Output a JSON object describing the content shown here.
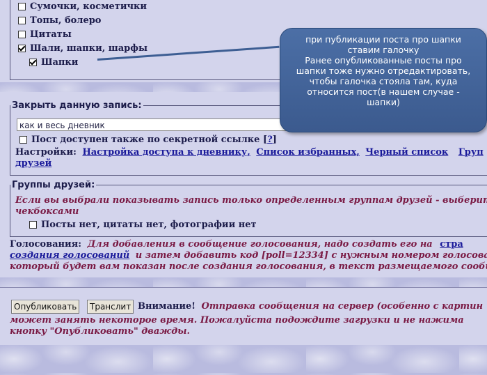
{
  "categories": {
    "items": [
      {
        "label": "Сумочки, косметички",
        "checked": false
      },
      {
        "label": "Топы, болеро",
        "checked": false
      },
      {
        "label": "Цитаты",
        "checked": false
      },
      {
        "label": "Шали, шапки, шарфы",
        "checked": true
      },
      {
        "label": "Шапки",
        "checked": true
      }
    ]
  },
  "callout": {
    "lines": [
      "при публикации поста про шапки",
      "ставим галочку",
      "Ранее опубликованные посты про",
      "шапки тоже нужно отредактировать,",
      "чтобы галочка стояла там, куда",
      "относится пост(в нашем случае -",
      "шапки)"
    ]
  },
  "close_entry": {
    "legend": "Закрыть данную запись:",
    "select_value": "как и весь дневник",
    "secret_link_label": "Пост доступен также по секретной ссылке [",
    "secret_link_q": "?",
    "secret_link_end": "]",
    "settings_label": "Настройки:",
    "links": [
      "Настройка доступа к дневнику,",
      "Список избранных,",
      "Черный список",
      "Груп"
    ],
    "links_line2": "друзей"
  },
  "friend_groups": {
    "legend": "Группы друзей:",
    "desc_line1": "Если вы выбрали показывать запись только определенным группам друзей - выберите",
    "desc_line2": "чекбоксами",
    "checkbox_label": "Посты нет, цитаты нет, фотографии нет"
  },
  "polls": {
    "label": "Голосования:",
    "text1": "Для добавления в сообщение голосования, надо создать его на",
    "link1": "стра",
    "link2": "создания голосований",
    "text2": "и затем добавить код [poll=12334] с нужным номером голосова",
    "text3": "который будет вам показан после создания голосования, в текст размещаемого сообщен"
  },
  "submit": {
    "publish_label": "Опубликовать",
    "translit_label": "Транслит",
    "warning_label": "Внимание!",
    "warning_line1": "Отправка сообщения на сервер (особенно с картин",
    "warning_line2": "может занять некоторое время. Пожалуйста подождите загрузки и не нажима",
    "warning_line3": "кнопку \"Опубликовать\" дважды."
  }
}
